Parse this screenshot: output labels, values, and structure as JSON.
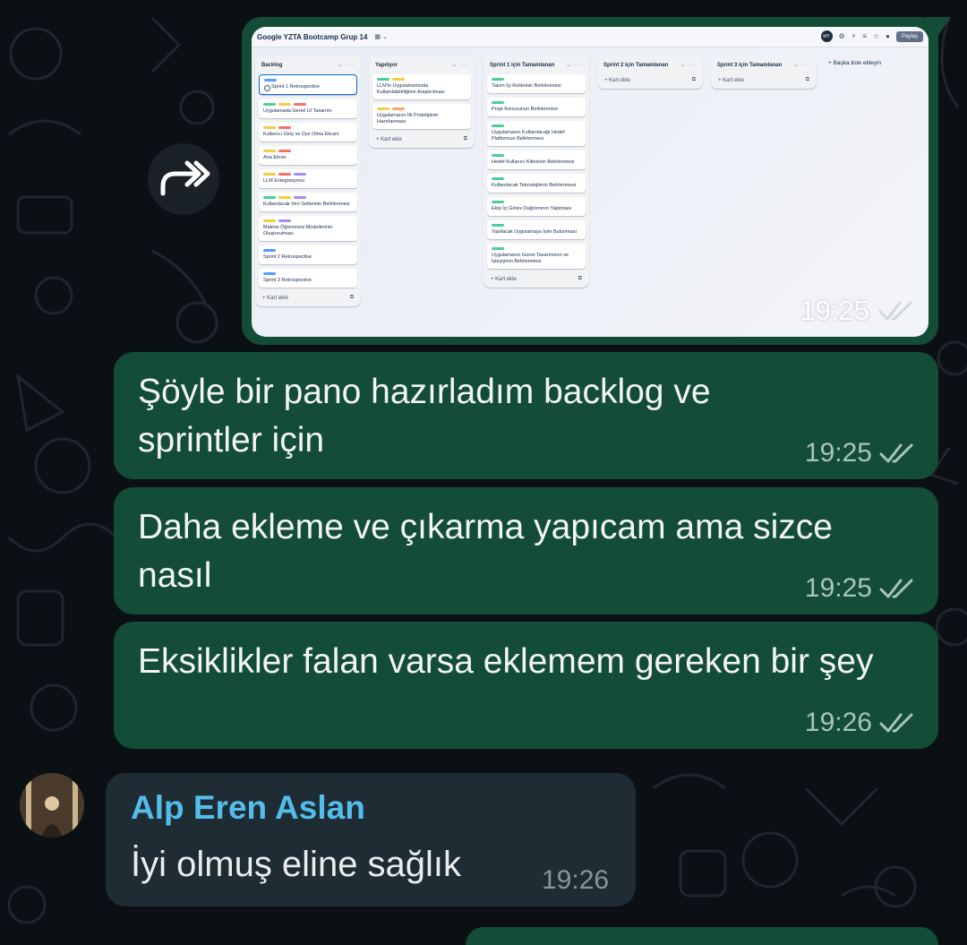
{
  "chat": {
    "image_message": {
      "time": "19:25",
      "screenshot": {
        "board_title": "Google YZTA Bootcamp Grup 14",
        "share_label": "Paylaş",
        "avatar_initials": "MY",
        "add_list_label": "+ Başka liste ekleyin",
        "lists": [
          {
            "title": "Backlog",
            "add_label": "+ Kart ekle",
            "cards": [
              {
                "text": "Sprint 1 Retrospective",
                "labels": [
                  "#579dff"
                ],
                "selected": true
              },
              {
                "text": "Uygulamada Genel UI Tasarımı",
                "labels": [
                  "#4bce97",
                  "#f5cd47",
                  "#f87168"
                ]
              },
              {
                "text": "Kullanıcı Giriş ve Üye Olma Ekranı",
                "labels": [
                  "#f5cd47",
                  "#f87168"
                ]
              },
              {
                "text": "Ana Ekran",
                "labels": [
                  "#f5cd47",
                  "#f87168"
                ]
              },
              {
                "text": "LLM Entegrasyonu",
                "labels": [
                  "#f5cd47",
                  "#f87168",
                  "#9f8fef"
                ]
              },
              {
                "text": "Kullanılacak Veri Setlerinin Belirlenmesi",
                "labels": [
                  "#4bce97",
                  "#f5cd47",
                  "#9f8fef"
                ]
              },
              {
                "text": "Makine Öğrenmesi Modellerinin Oluşturulması",
                "labels": [
                  "#f5cd47",
                  "#9f8fef"
                ]
              },
              {
                "text": "Sprint 2 Retrospective",
                "labels": [
                  "#579dff"
                ]
              },
              {
                "text": "Sprint 3 Retrospective",
                "labels": [
                  "#579dff"
                ]
              }
            ]
          },
          {
            "title": "Yapılıyor",
            "add_label": "+ Kart ekle",
            "cards": [
              {
                "text": "LLM'in Uygulamamızda Kullanılabilirliğinin Araştırılması",
                "labels": [
                  "#4bce97",
                  "#f5cd47"
                ]
              },
              {
                "text": "Uygulamanın İlk Prototipinin Hazırlanması",
                "labels": [
                  "#f5cd47",
                  "#fea362"
                ]
              }
            ]
          },
          {
            "title": "Sprint 1 için Tamamlanan",
            "add_label": "+ Kart ekle",
            "cards": [
              {
                "text": "Takım İçi Rollerinin Belirlenmesi",
                "labels": [
                  "#4bce97"
                ]
              },
              {
                "text": "Proje Konusunun Belirlenmesi",
                "labels": [
                  "#4bce97"
                ]
              },
              {
                "text": "Uygulamanın Kullanılacağı Hedef Platformun Belirlenmesi",
                "labels": [
                  "#4bce97"
                ]
              },
              {
                "text": "Hedef Kullanıcı Kitlesinin Belirlenmesi",
                "labels": [
                  "#4bce97"
                ]
              },
              {
                "text": "Kullanılacak Teknolojilerin Belirlenmesi",
                "labels": [
                  "#4bce97"
                ]
              },
              {
                "text": "Ekip İçi Görev Dağılımının Yapılması",
                "labels": [
                  "#4bce97"
                ]
              },
              {
                "text": "Yapılacak Uygulamaya İsim Bulunması",
                "labels": [
                  "#4bce97"
                ]
              },
              {
                "text": "Uygulamanın Genel Tasarımının ve İşleyişinin Belirlenmesi",
                "labels": [
                  "#4bce97"
                ]
              }
            ]
          },
          {
            "title": "Sprint 2 için Tamamlanan",
            "add_label": "+ Kart ekle",
            "cards": []
          },
          {
            "title": "Sprint 3 için Tamamlanan",
            "add_label": "+ Kart ekle",
            "cards": []
          }
        ]
      }
    },
    "outgoing": [
      {
        "text": "Şöyle bir pano hazırladım backlog ve sprintler için",
        "time": "19:25"
      },
      {
        "text": "Daha ekleme ve çıkarma yapıcam ama sizce nasıl",
        "time": "19:25"
      },
      {
        "text": "Eksiklikler falan varsa eklemem gereken bir şey",
        "time": "19:26"
      }
    ],
    "incoming": {
      "sender": "Alp Eren Aslan",
      "text": "İyi olmuş eline sağlık",
      "time": "19:26"
    },
    "icons": {
      "forward": "forward-arrow-icon",
      "read_receipt": "double-check-icon"
    },
    "colors": {
      "background": "#0b1014",
      "outgoing_bubble": "#134d37",
      "incoming_bubble": "#1f2c33",
      "sender_name": "#53bdeb"
    }
  }
}
